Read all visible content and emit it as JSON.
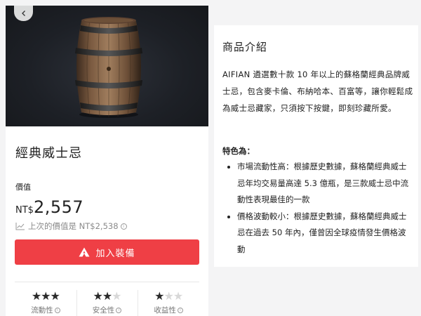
{
  "product": {
    "title": "經典威士忌",
    "price_label": "價值",
    "currency": "NT$",
    "price": "2,557",
    "previous_price_text": "上次的價值是 NT$2,538",
    "info_glyph": "i",
    "equip_button_label": "加入裝備"
  },
  "ratings": [
    {
      "label": "流動性",
      "filled": 3,
      "total": 3
    },
    {
      "label": "安全性",
      "filled": 2,
      "total": 3
    },
    {
      "label": "收益性",
      "filled": 1,
      "total": 3
    }
  ],
  "description": {
    "title": "商品介紹",
    "intro": "AIFIAN 遴選數十款 10 年以上的蘇格蘭經典品牌威士忌，包含麥卡倫、布納哈本、百富等，讓你輕鬆成為威士忌藏家，只須按下按鍵，即刻珍藏所愛。",
    "features_title": "特色為：",
    "features": [
      "市場流動性高：根據歷史數據，蘇格蘭經典威士忌年均交易量高達 5.3 億瓶，是三款威士忌中流動性表現最佳的一款",
      "價格波動較小：根據歷史數據，蘇格蘭經典威士忌在過去 50 年內，僅曾因全球疫情發生價格波動"
    ]
  },
  "icons": {
    "back": "chevron-left-icon",
    "history": "line-chart-icon",
    "info": "info-icon",
    "equip": "brand-logo-icon",
    "star": "star-icon",
    "product_image": "wooden-barrel"
  },
  "colors": {
    "accent": "#ef3f45",
    "hero_bg": "#1d2026",
    "star_on": "#2a2a2a",
    "star_off": "#d8d8d8"
  }
}
